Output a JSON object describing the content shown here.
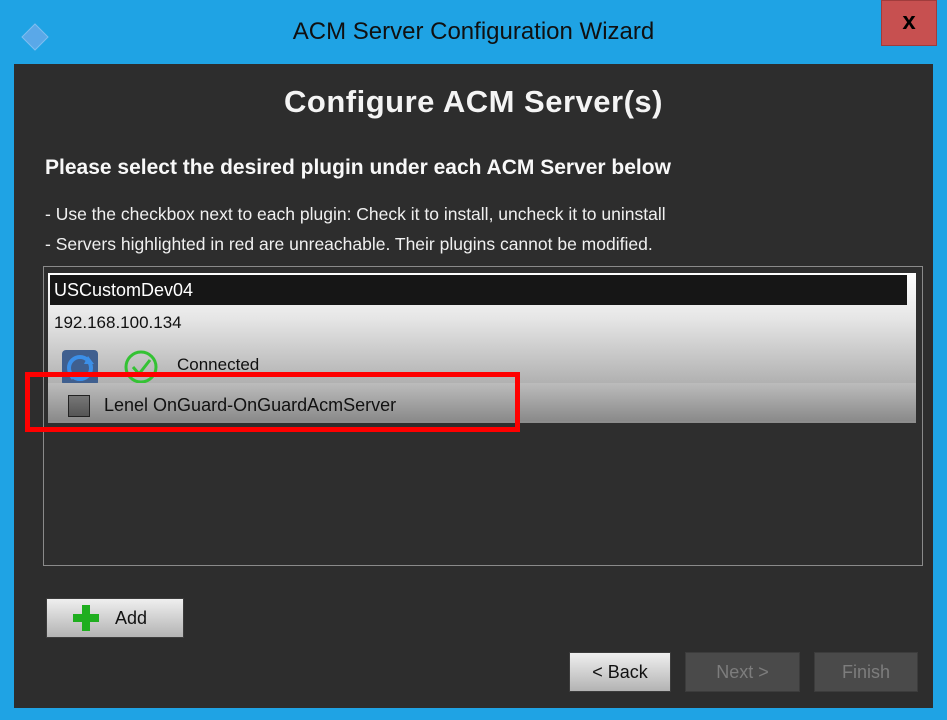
{
  "window": {
    "title": "ACM Server Configuration Wizard",
    "close_glyph": "x"
  },
  "page": {
    "heading": "Configure ACM Server(s)",
    "subheading": "Please select the desired plugin under each ACM Server below",
    "notes": [
      "- Use the checkbox next to each plugin: Check it to install, uncheck it to uninstall",
      "- Servers highlighted in red are unreachable. Their plugins cannot be modified."
    ]
  },
  "servers": [
    {
      "name": "USCustomDev04",
      "ip": "192.168.100.134",
      "status": "Connected",
      "plugins": [
        {
          "label": "Lenel OnGuard-OnGuardAcmServer",
          "checked": false
        }
      ]
    }
  ],
  "buttons": {
    "add": "Add",
    "back": "< Back",
    "next": "Next >",
    "finish": "Finish"
  },
  "colors": {
    "title_bar": "#1fa3e4",
    "client_bg": "#2d2d2d",
    "close_button": "#c75050",
    "highlight": "#ff0000",
    "connected_check": "#34c234"
  },
  "icons": {
    "app": "app-diamond-icon",
    "refresh": "refresh-icon",
    "status": "connected-check-icon",
    "add": "plus-icon"
  }
}
